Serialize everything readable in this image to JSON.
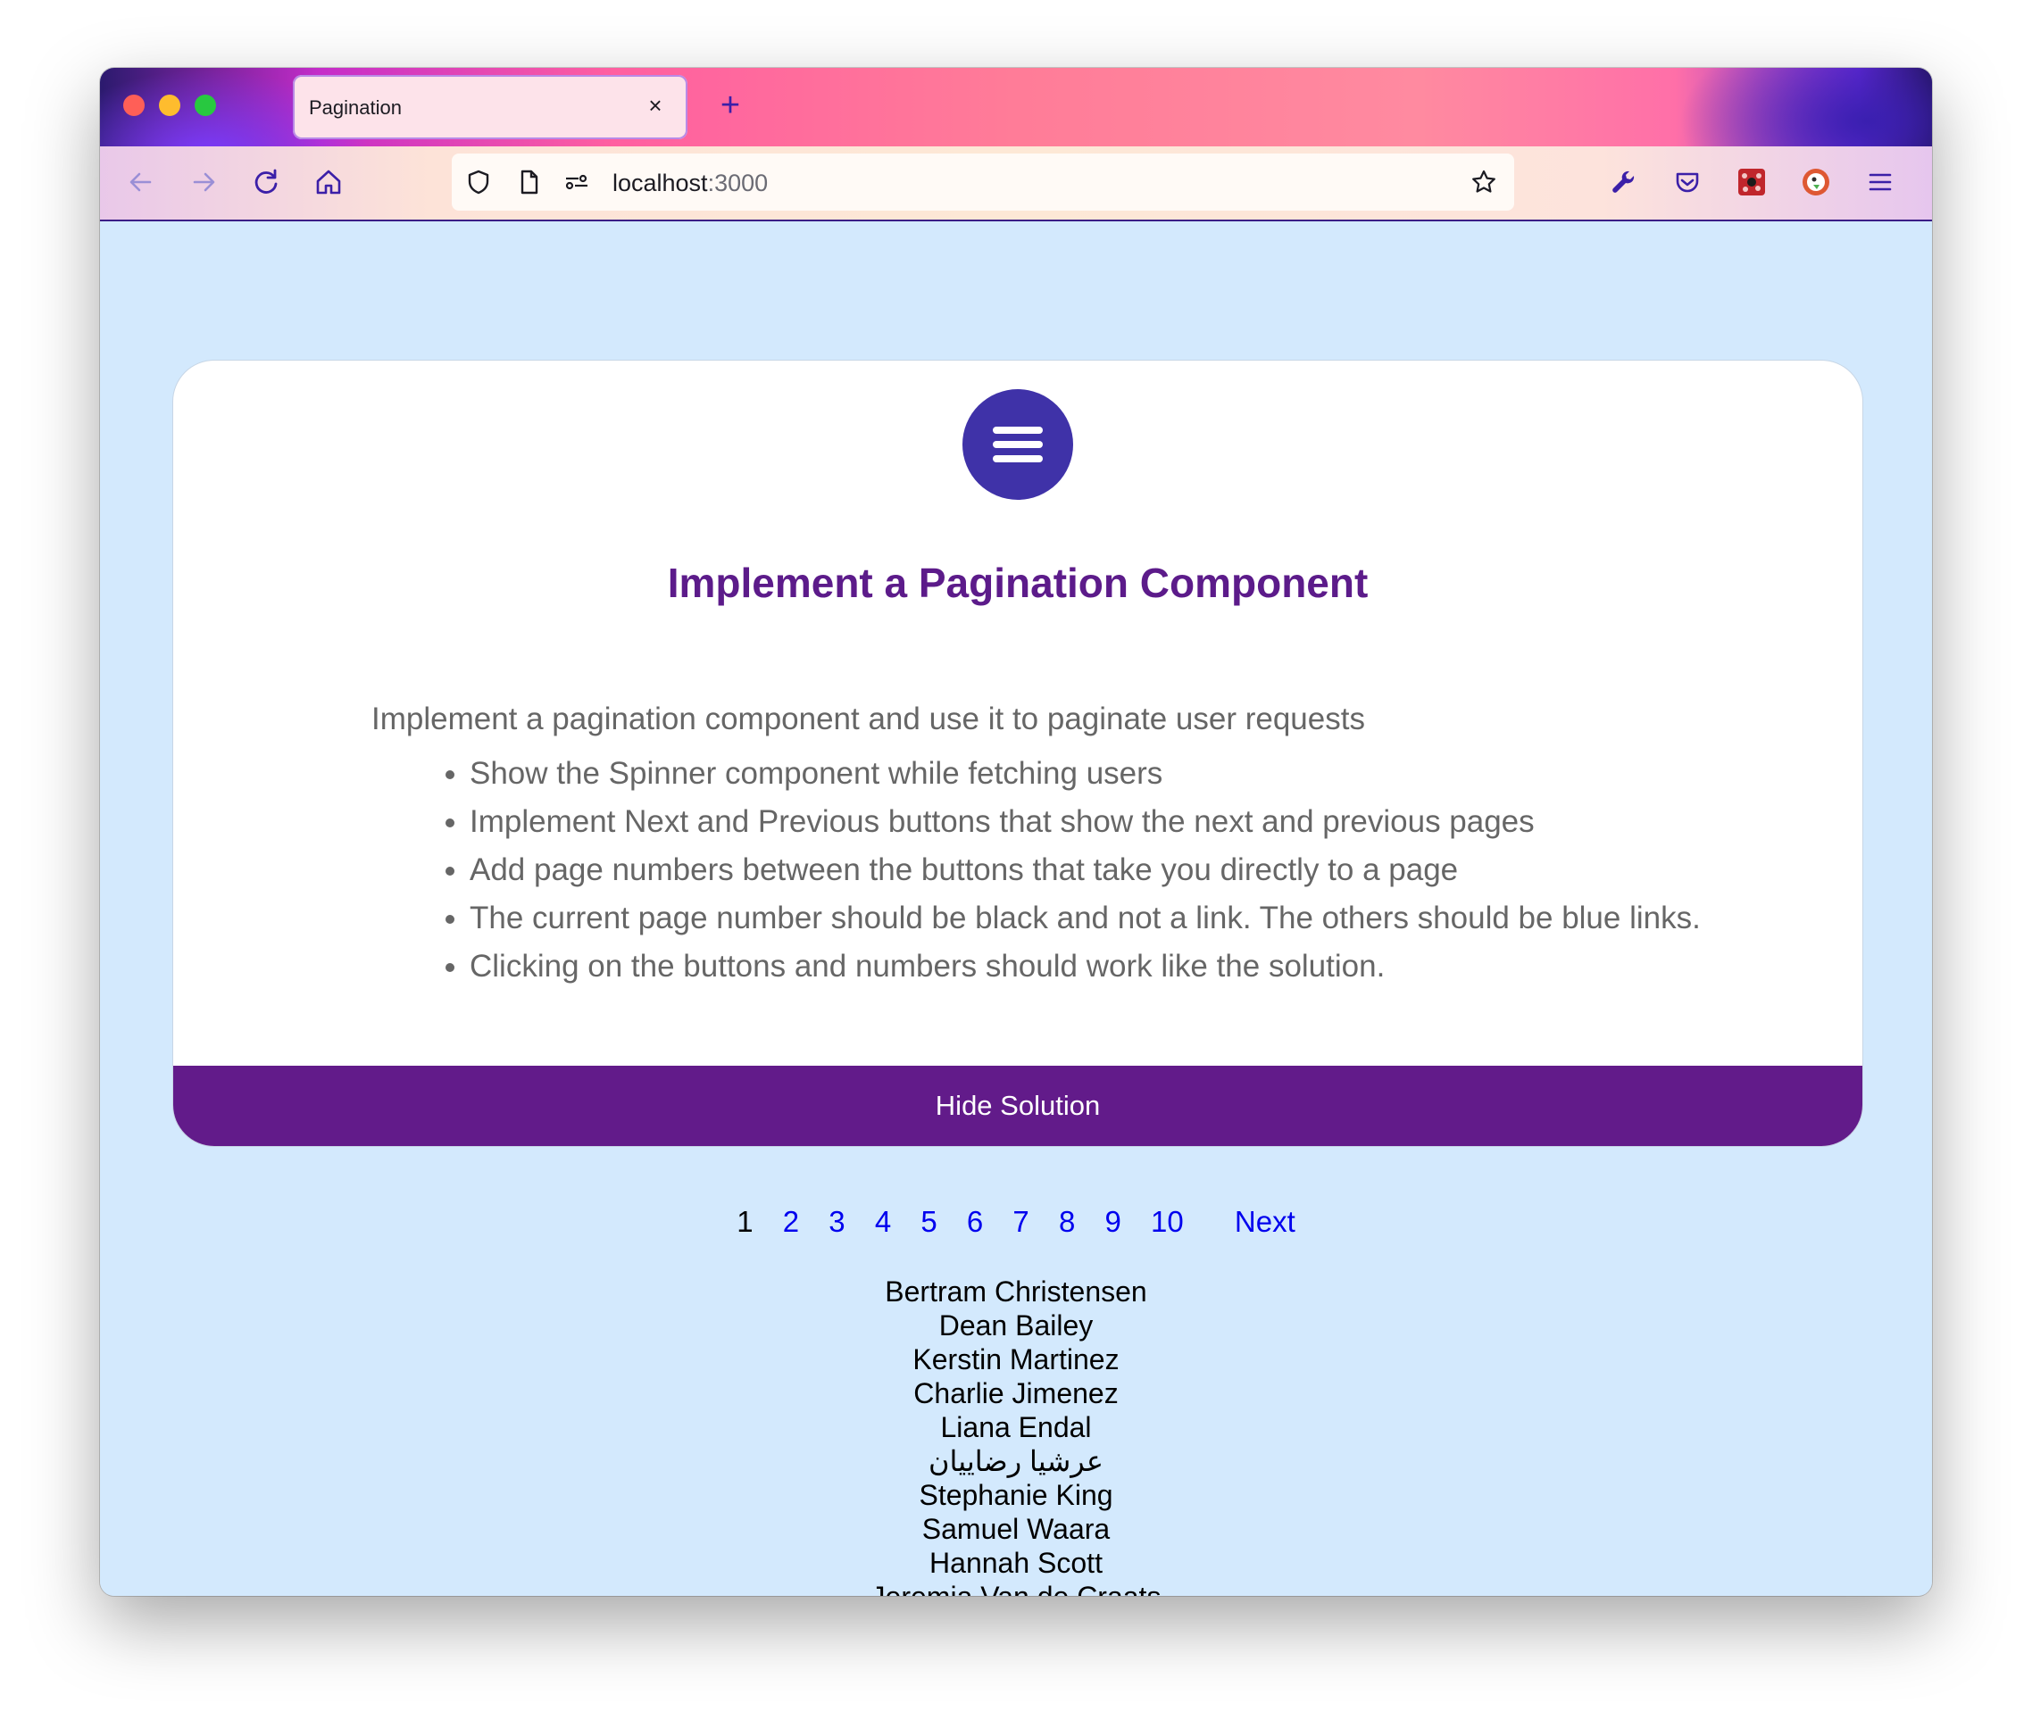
{
  "browser": {
    "tab_title": "Pagination",
    "tab_close": "×",
    "new_tab": "+",
    "url_host": "localhost",
    "url_port": ":3000"
  },
  "card": {
    "title": "Implement a Pagination Component",
    "intro": "Implement a pagination component and use it to paginate user requests",
    "requirements": [
      "Show the Spinner component while fetching users",
      "Implement Next and Previous buttons that show the next and previous pages",
      "Add page numbers between the buttons that take you directly to a page",
      "The current page number should be black and not a link. The others should be blue links.",
      "Clicking on the buttons and numbers should work like the solution."
    ],
    "solution_button": "Hide Solution"
  },
  "pagination": {
    "current": "1",
    "pages": [
      "2",
      "3",
      "4",
      "5",
      "6",
      "7",
      "8",
      "9",
      "10"
    ],
    "next_label": "Next"
  },
  "users": [
    "Bertram Christensen",
    "Dean Bailey",
    "Kerstin Martinez",
    "Charlie Jimenez",
    "Liana Endal",
    "عرشیا رضاییان",
    "Stephanie King",
    "Samuel Waara",
    "Hannah Scott",
    "Jeremia Van de Craats"
  ],
  "colors": {
    "page_bg": "#d3e9fd",
    "accent_purple": "#621b8a",
    "title_purple": "#5c1b8a",
    "link_blue": "#0000ee",
    "logo_circle": "#3f32a8"
  },
  "icons": {
    "toolbar": [
      "wrench-icon",
      "pocket-icon",
      "extension-icon",
      "duckduckgo-icon",
      "menu-icon"
    ]
  }
}
